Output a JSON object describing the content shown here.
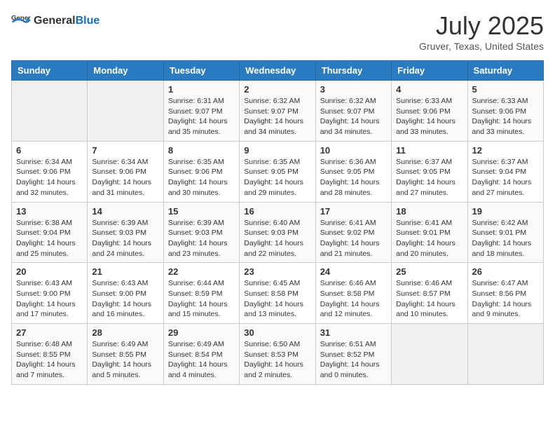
{
  "logo": {
    "general": "General",
    "blue": "Blue"
  },
  "title": "July 2025",
  "location": "Gruver, Texas, United States",
  "days_of_week": [
    "Sunday",
    "Monday",
    "Tuesday",
    "Wednesday",
    "Thursday",
    "Friday",
    "Saturday"
  ],
  "weeks": [
    [
      {
        "day": "",
        "data": ""
      },
      {
        "day": "",
        "data": ""
      },
      {
        "day": "1",
        "data": "Sunrise: 6:31 AM\nSunset: 9:07 PM\nDaylight: 14 hours and 35 minutes."
      },
      {
        "day": "2",
        "data": "Sunrise: 6:32 AM\nSunset: 9:07 PM\nDaylight: 14 hours and 34 minutes."
      },
      {
        "day": "3",
        "data": "Sunrise: 6:32 AM\nSunset: 9:07 PM\nDaylight: 14 hours and 34 minutes."
      },
      {
        "day": "4",
        "data": "Sunrise: 6:33 AM\nSunset: 9:06 PM\nDaylight: 14 hours and 33 minutes."
      },
      {
        "day": "5",
        "data": "Sunrise: 6:33 AM\nSunset: 9:06 PM\nDaylight: 14 hours and 33 minutes."
      }
    ],
    [
      {
        "day": "6",
        "data": "Sunrise: 6:34 AM\nSunset: 9:06 PM\nDaylight: 14 hours and 32 minutes."
      },
      {
        "day": "7",
        "data": "Sunrise: 6:34 AM\nSunset: 9:06 PM\nDaylight: 14 hours and 31 minutes."
      },
      {
        "day": "8",
        "data": "Sunrise: 6:35 AM\nSunset: 9:06 PM\nDaylight: 14 hours and 30 minutes."
      },
      {
        "day": "9",
        "data": "Sunrise: 6:35 AM\nSunset: 9:05 PM\nDaylight: 14 hours and 29 minutes."
      },
      {
        "day": "10",
        "data": "Sunrise: 6:36 AM\nSunset: 9:05 PM\nDaylight: 14 hours and 28 minutes."
      },
      {
        "day": "11",
        "data": "Sunrise: 6:37 AM\nSunset: 9:05 PM\nDaylight: 14 hours and 27 minutes."
      },
      {
        "day": "12",
        "data": "Sunrise: 6:37 AM\nSunset: 9:04 PM\nDaylight: 14 hours and 27 minutes."
      }
    ],
    [
      {
        "day": "13",
        "data": "Sunrise: 6:38 AM\nSunset: 9:04 PM\nDaylight: 14 hours and 25 minutes."
      },
      {
        "day": "14",
        "data": "Sunrise: 6:39 AM\nSunset: 9:03 PM\nDaylight: 14 hours and 24 minutes."
      },
      {
        "day": "15",
        "data": "Sunrise: 6:39 AM\nSunset: 9:03 PM\nDaylight: 14 hours and 23 minutes."
      },
      {
        "day": "16",
        "data": "Sunrise: 6:40 AM\nSunset: 9:03 PM\nDaylight: 14 hours and 22 minutes."
      },
      {
        "day": "17",
        "data": "Sunrise: 6:41 AM\nSunset: 9:02 PM\nDaylight: 14 hours and 21 minutes."
      },
      {
        "day": "18",
        "data": "Sunrise: 6:41 AM\nSunset: 9:01 PM\nDaylight: 14 hours and 20 minutes."
      },
      {
        "day": "19",
        "data": "Sunrise: 6:42 AM\nSunset: 9:01 PM\nDaylight: 14 hours and 18 minutes."
      }
    ],
    [
      {
        "day": "20",
        "data": "Sunrise: 6:43 AM\nSunset: 9:00 PM\nDaylight: 14 hours and 17 minutes."
      },
      {
        "day": "21",
        "data": "Sunrise: 6:43 AM\nSunset: 9:00 PM\nDaylight: 14 hours and 16 minutes."
      },
      {
        "day": "22",
        "data": "Sunrise: 6:44 AM\nSunset: 8:59 PM\nDaylight: 14 hours and 15 minutes."
      },
      {
        "day": "23",
        "data": "Sunrise: 6:45 AM\nSunset: 8:58 PM\nDaylight: 14 hours and 13 minutes."
      },
      {
        "day": "24",
        "data": "Sunrise: 6:46 AM\nSunset: 8:58 PM\nDaylight: 14 hours and 12 minutes."
      },
      {
        "day": "25",
        "data": "Sunrise: 6:46 AM\nSunset: 8:57 PM\nDaylight: 14 hours and 10 minutes."
      },
      {
        "day": "26",
        "data": "Sunrise: 6:47 AM\nSunset: 8:56 PM\nDaylight: 14 hours and 9 minutes."
      }
    ],
    [
      {
        "day": "27",
        "data": "Sunrise: 6:48 AM\nSunset: 8:55 PM\nDaylight: 14 hours and 7 minutes."
      },
      {
        "day": "28",
        "data": "Sunrise: 6:49 AM\nSunset: 8:55 PM\nDaylight: 14 hours and 5 minutes."
      },
      {
        "day": "29",
        "data": "Sunrise: 6:49 AM\nSunset: 8:54 PM\nDaylight: 14 hours and 4 minutes."
      },
      {
        "day": "30",
        "data": "Sunrise: 6:50 AM\nSunset: 8:53 PM\nDaylight: 14 hours and 2 minutes."
      },
      {
        "day": "31",
        "data": "Sunrise: 6:51 AM\nSunset: 8:52 PM\nDaylight: 14 hours and 0 minutes."
      },
      {
        "day": "",
        "data": ""
      },
      {
        "day": "",
        "data": ""
      }
    ]
  ]
}
